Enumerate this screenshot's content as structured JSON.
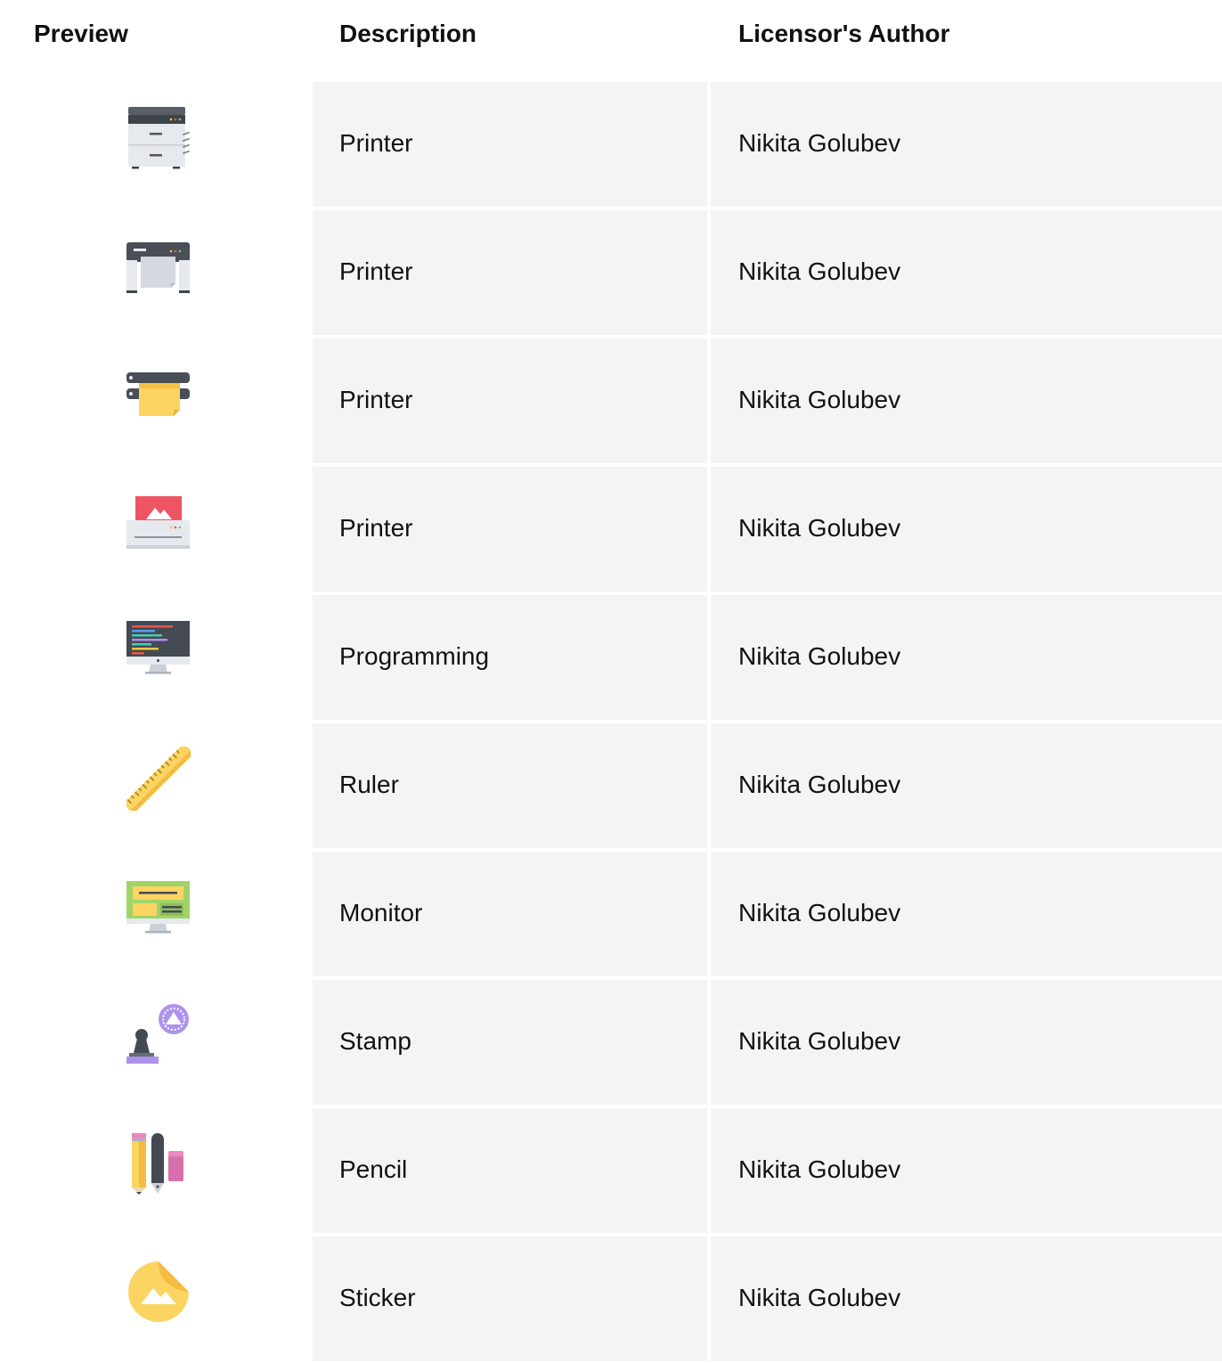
{
  "table": {
    "headers": {
      "preview": "Preview",
      "description": "Description",
      "author": "Licensor's Author"
    },
    "rows": [
      {
        "icon": "copier-printer-icon",
        "description": "Printer",
        "author": "Nikita Golubev"
      },
      {
        "icon": "plotter-printer-icon",
        "description": "Printer",
        "author": "Nikita Golubev"
      },
      {
        "icon": "wide-format-printer-icon",
        "description": "Printer",
        "author": "Nikita Golubev"
      },
      {
        "icon": "photo-printer-icon",
        "description": "Printer",
        "author": "Nikita Golubev"
      },
      {
        "icon": "code-monitor-icon",
        "description": "Programming",
        "author": "Nikita Golubev"
      },
      {
        "icon": "ruler-icon",
        "description": "Ruler",
        "author": "Nikita Golubev"
      },
      {
        "icon": "layout-monitor-icon",
        "description": "Monitor",
        "author": "Nikita Golubev"
      },
      {
        "icon": "stamp-icon",
        "description": "Stamp",
        "author": "Nikita Golubev"
      },
      {
        "icon": "pencil-pen-eraser-icon",
        "description": "Pencil",
        "author": "Nikita Golubev"
      },
      {
        "icon": "sticker-icon",
        "description": "Sticker",
        "author": "Nikita Golubev"
      }
    ]
  }
}
